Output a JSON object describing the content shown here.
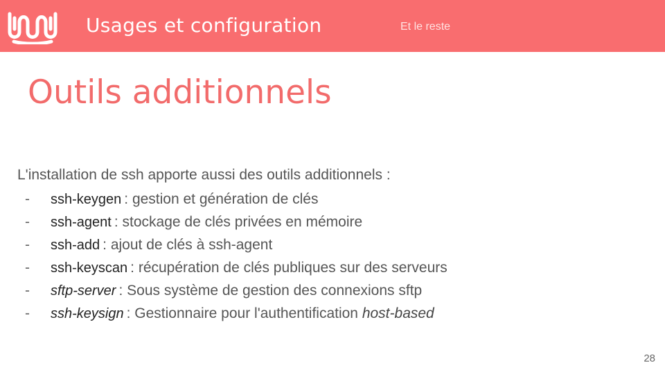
{
  "header": {
    "title": "Usages et configuration",
    "section": "Et le reste"
  },
  "slide": {
    "title": "Outils additionnels",
    "intro": "L'installation de ssh apporte aussi des outils additionnels :",
    "items": [
      {
        "name": "ssh-keygen",
        "description": ": gestion et génération de clés",
        "italic": false
      },
      {
        "name": "ssh-agent",
        "description": ": stockage de clés privées en mémoire",
        "italic": false
      },
      {
        "name": "ssh-add",
        "description": ": ajout de clés à ssh-agent",
        "italic": false
      },
      {
        "name": "ssh-keyscan",
        "description": ": récupération de clés publiques sur des serveurs",
        "italic": false
      },
      {
        "name": "sftp-server",
        "description": ": Sous système de gestion des connexions sftp",
        "italic": true
      },
      {
        "name": "ssh-keysign",
        "description": ": Gestionnaire pour l'authentification ",
        "emphasis": "host-based",
        "italic": true
      }
    ],
    "bullet": "-"
  },
  "page_number": "28",
  "colors": {
    "header_bg": "#f96d6f",
    "title": "#f26b6b",
    "text": "#555555"
  },
  "icons": {
    "logo": "wave-logo-icon"
  }
}
